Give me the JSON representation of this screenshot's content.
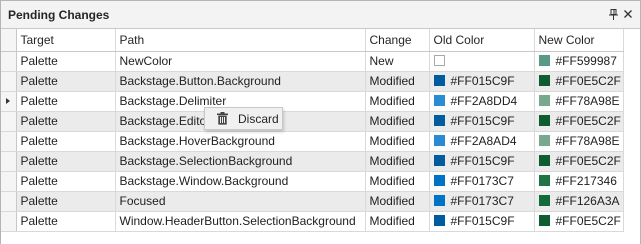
{
  "panel": {
    "title": "Pending Changes",
    "pin_icon": "pin-icon",
    "close_icon": "close-icon"
  },
  "columns": {
    "target": "Target",
    "path": "Path",
    "change": "Change",
    "old_color": "Old Color",
    "new_color": "New Color"
  },
  "rows": [
    {
      "target": "Palette",
      "path": "NewColor",
      "change": "New",
      "old_color": "",
      "old_swatch": "",
      "new_color": "#FF599987",
      "new_swatch": "#599987",
      "current": false
    },
    {
      "target": "Palette",
      "path": "Backstage.Button.Background",
      "change": "Modified",
      "old_color": "#FF015C9F",
      "old_swatch": "#015C9F",
      "new_color": "#FF0E5C2F",
      "new_swatch": "#0E5C2F",
      "current": false
    },
    {
      "target": "Palette",
      "path": "Backstage.Delimiter",
      "change": "Modified",
      "old_color": "#FF2A8DD4",
      "old_swatch": "#2A8DD4",
      "new_color": "#FF78A98E",
      "new_swatch": "#78A98E",
      "current": true
    },
    {
      "target": "Palette",
      "path": "Backstage.Editor",
      "change": "Modified",
      "old_color": "#FF015C9F",
      "old_swatch": "#015C9F",
      "new_color": "#FF0E5C2F",
      "new_swatch": "#0E5C2F",
      "current": false
    },
    {
      "target": "Palette",
      "path": "Backstage.HoverBackground",
      "change": "Modified",
      "old_color": "#FF2A8AD4",
      "old_swatch": "#2A8AD4",
      "new_color": "#FF78A98E",
      "new_swatch": "#78A98E",
      "current": false
    },
    {
      "target": "Palette",
      "path": "Backstage.SelectionBackground",
      "change": "Modified",
      "old_color": "#FF015C9F",
      "old_swatch": "#015C9F",
      "new_color": "#FF0E5C2F",
      "new_swatch": "#0E5C2F",
      "current": false
    },
    {
      "target": "Palette",
      "path": "Backstage.Window.Background",
      "change": "Modified",
      "old_color": "#FF0173C7",
      "old_swatch": "#0173C7",
      "new_color": "#FF217346",
      "new_swatch": "#217346",
      "current": false
    },
    {
      "target": "Palette",
      "path": "Focused",
      "change": "Modified",
      "old_color": "#FF0173C7",
      "old_swatch": "#0173C7",
      "new_color": "#FF126A3A",
      "new_swatch": "#126A3A",
      "current": false
    },
    {
      "target": "Palette",
      "path": "Window.HeaderButton.SelectionBackground",
      "change": "Modified",
      "old_color": "#FF015C9F",
      "old_swatch": "#015C9F",
      "new_color": "#FF0E5C2F",
      "new_swatch": "#0E5C2F",
      "current": false
    }
  ],
  "context_menu": {
    "discard_label": "Discard",
    "discard_icon": "trash-icon"
  },
  "colors": {
    "alt_row": "#EBEBEB",
    "header_bg": "#F3F3F3"
  }
}
